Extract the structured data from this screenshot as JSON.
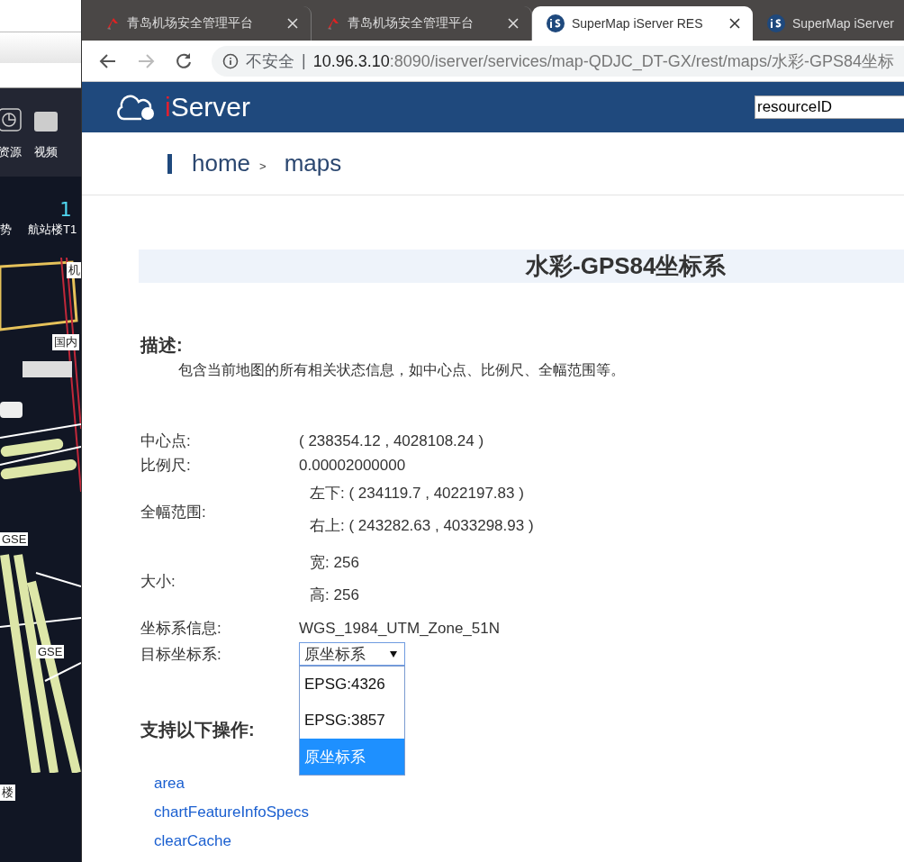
{
  "background_window": {
    "nav_items": [
      "资源",
      "视频"
    ],
    "counter": "1",
    "map_tabs": [
      "势",
      "航站楼T1"
    ],
    "map_labels": [
      "机",
      "国内",
      "GSE",
      "GSE",
      "楼"
    ]
  },
  "browser": {
    "tabs": [
      {
        "kind": "app",
        "title": "青岛机场安全管理平台",
        "selected": false
      },
      {
        "kind": "app",
        "title": "青岛机场安全管理平台",
        "selected": false
      },
      {
        "kind": "supermap",
        "title": "SuperMap iServer RES",
        "selected": true
      },
      {
        "kind": "supermap",
        "title": "SuperMap iServer",
        "selected": false
      }
    ],
    "address": {
      "security": "不安全",
      "separator": "|",
      "host": "10.96.3.10",
      "path": ":8090/iserver/services/map-QDJC_DT-GX/rest/maps/水彩-GPS84坐标"
    }
  },
  "header": {
    "logo": "iServer",
    "search": {
      "value": "resourceID"
    }
  },
  "breadcrumb": {
    "items": [
      "home",
      "maps"
    ],
    "separator": ">"
  },
  "title": "水彩-GPS84坐标系",
  "description": {
    "heading": "描述:",
    "text": "包含当前地图的所有相关状态信息，如中心点、比例尺、全幅范围等。"
  },
  "properties": [
    {
      "kind": "text",
      "label": "中心点:",
      "value": "( 238354.12 , 4028108.24 )"
    },
    {
      "kind": "text",
      "label": "比例尺:",
      "value": "0.00002000000"
    },
    {
      "kind": "pairs",
      "label": "全幅范围:",
      "items": [
        {
          "label": "左下:",
          "value": "( 234119.7 , 4022197.83 )"
        },
        {
          "label": "右上:",
          "value": "( 243282.63 , 4033298.93 )"
        }
      ]
    },
    {
      "kind": "pairs",
      "label": "大小:",
      "items": [
        {
          "label": "宽:",
          "value": "256"
        },
        {
          "label": "高:",
          "value": "256"
        }
      ]
    },
    {
      "kind": "text",
      "label": "坐标系信息:",
      "value": "WGS_1984_UTM_Zone_51N"
    },
    {
      "kind": "select",
      "label": "目标坐标系:",
      "value": "原坐标系",
      "expanded": true,
      "options": [
        {
          "label": "EPSG:4326",
          "selected": false
        },
        {
          "label": "EPSG:3857",
          "selected": false
        },
        {
          "label": "原坐标系",
          "selected": true
        }
      ]
    }
  ],
  "operations": {
    "heading": "支持以下操作:",
    "links": [
      "area",
      "chartFeatureInfoSpecs",
      "clearCache"
    ]
  }
}
